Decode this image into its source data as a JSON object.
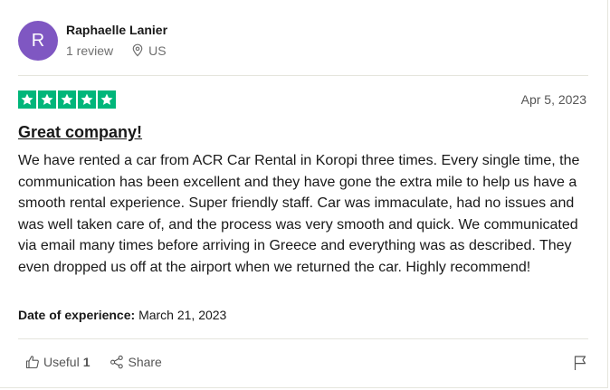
{
  "review": {
    "author": {
      "initial": "R",
      "name": "Raphaelle Lanier",
      "review_count": "1 review",
      "country": "US",
      "avatar_color": "#7f57c2"
    },
    "rating": 5,
    "rating_color": "#00b67a",
    "date": "Apr 5, 2023",
    "title": "Great company!",
    "body": "We have rented a car from ACR Car Rental in Koropi three times. Every single time, the communication has been excellent and they have gone the extra mile to help us have a smooth rental experience. Super friendly staff. Car was immaculate, had no issues and was well taken care of, and the process was very smooth and quick. We communicated via email many times before arriving in Greece and everything was as described. They even dropped us off at the airport when we returned the car. Highly recommend!",
    "experience_label": "Date of experience:",
    "experience_date": "March 21, 2023",
    "actions": {
      "useful_label": "Useful",
      "useful_count": "1",
      "share_label": "Share"
    },
    "icons": {
      "location": "location-pin-icon",
      "star": "star-icon",
      "useful": "thumbs-up-icon",
      "share": "share-icon",
      "flag": "flag-icon"
    }
  }
}
